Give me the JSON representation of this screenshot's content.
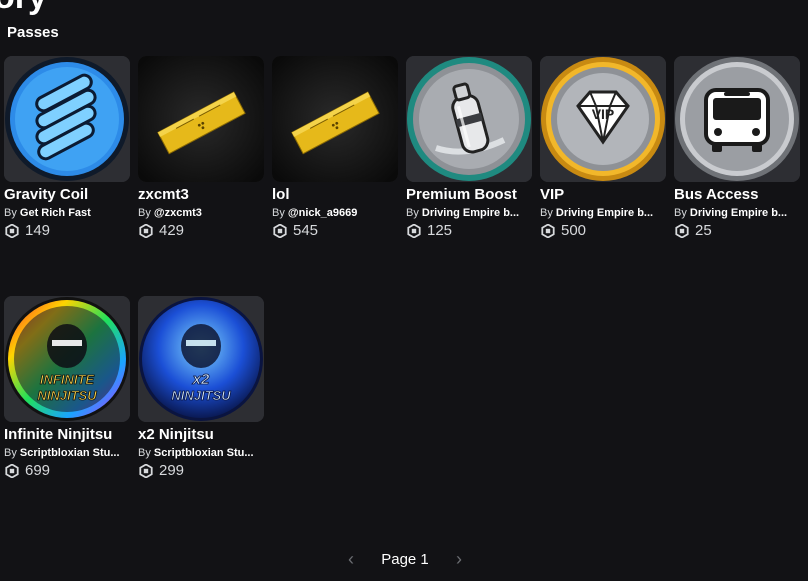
{
  "header": {
    "title": "ory",
    "section_label": "Passes"
  },
  "items": [
    {
      "name": "Gravity Coil",
      "by": "By",
      "creator": "Get Rich Fast",
      "price": "149",
      "icon": "gravity-coil-icon"
    },
    {
      "name": "zxcmt3",
      "by": "By",
      "creator": "@zxcmt3",
      "price": "429",
      "icon": "gold-ticket-icon"
    },
    {
      "name": "lol",
      "by": "By",
      "creator": "@nick_a9669",
      "price": "545",
      "icon": "gold-ticket-icon"
    },
    {
      "name": "Premium Boost",
      "by": "By",
      "creator": "Driving Empire b...",
      "price": "125",
      "icon": "nitro-bottle-icon"
    },
    {
      "name": "VIP",
      "by": "By",
      "creator": "Driving Empire b...",
      "price": "500",
      "icon": "vip-diamond-icon"
    },
    {
      "name": "Bus Access",
      "by": "By",
      "creator": "Driving Empire b...",
      "price": "25",
      "icon": "bus-icon"
    },
    {
      "name": "Infinite Ninjitsu",
      "by": "By",
      "creator": "Scriptbloxian Stu...",
      "price": "699",
      "icon": "ninja-rainbow-icon",
      "badge_line1": "INFINITE",
      "badge_line2": "NINJITSU"
    },
    {
      "name": "x2 Ninjitsu",
      "by": "By",
      "creator": "Scriptbloxian Stu...",
      "price": "299",
      "icon": "ninja-blue-icon",
      "badge_line1": "x2",
      "badge_line2": "NINJITSU"
    }
  ],
  "pagination": {
    "label": "Page 1",
    "prev_icon": "chevron-left-icon",
    "next_icon": "chevron-right-icon"
  },
  "colors": {
    "background": "#121215",
    "card_thumb": "#2d2e33",
    "muted_text": "#d7d9dc"
  }
}
